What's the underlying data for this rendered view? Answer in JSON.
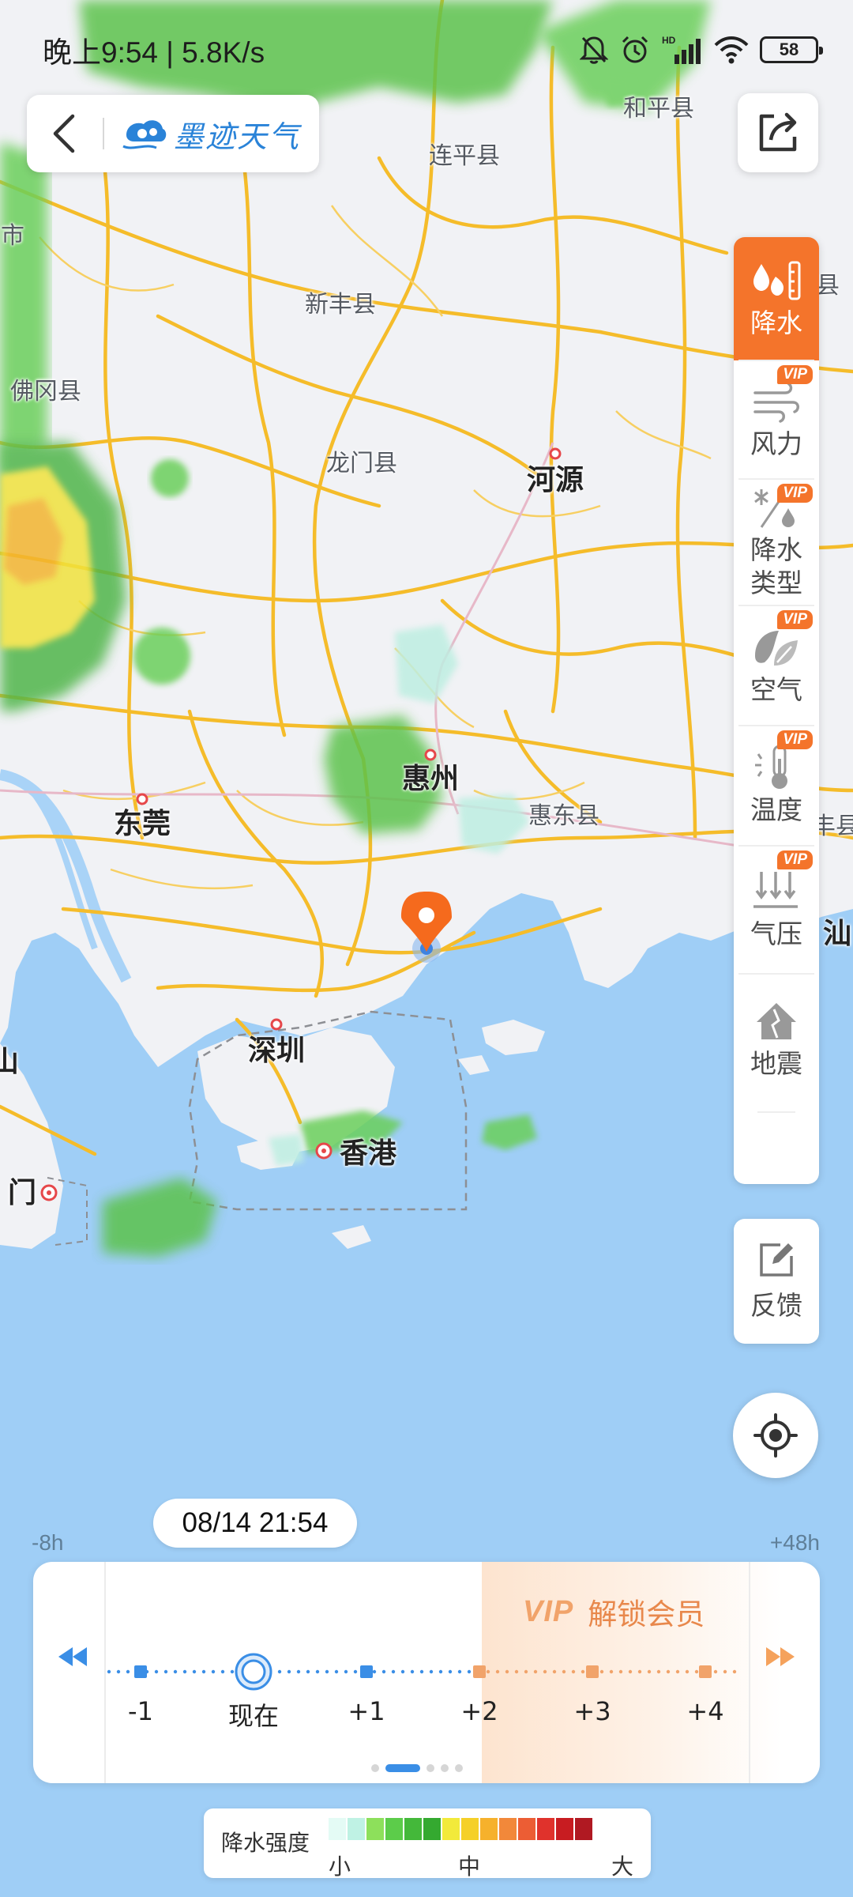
{
  "status_bar": {
    "time_speed": "晚上9:54 | 5.8K/s",
    "network_badge": "HD",
    "battery": "58",
    "icons": [
      "mute-icon",
      "alarm-icon",
      "signal-icon",
      "wifi-icon",
      "battery-icon"
    ]
  },
  "header": {
    "back_icon": "chevron-left-icon",
    "brand_logo": "moji-logo-icon",
    "brand_name": "墨迹天气",
    "share_icon": "share-icon"
  },
  "map": {
    "places": [
      {
        "name": "连平县",
        "rank": "minor"
      },
      {
        "name": "和平县",
        "rank": "minor"
      },
      {
        "name": "新丰县",
        "rank": "minor"
      },
      {
        "name": "佛冈县",
        "rank": "minor"
      },
      {
        "name": "龙门县",
        "rank": "minor"
      },
      {
        "name": "河源",
        "rank": "major"
      },
      {
        "name": "惠州",
        "rank": "major"
      },
      {
        "name": "东莞",
        "rank": "major"
      },
      {
        "name": "惠东县",
        "rank": "minor"
      },
      {
        "name": "深圳",
        "rank": "major"
      },
      {
        "name": "香港",
        "rank": "major"
      },
      {
        "name": "门",
        "rank": "major"
      },
      {
        "name": "市",
        "rank": "minor"
      },
      {
        "name": "县",
        "rank": "minor"
      },
      {
        "name": "丰县",
        "rank": "minor"
      },
      {
        "name": "汕",
        "rank": "major"
      },
      {
        "name": "山",
        "rank": "major"
      }
    ],
    "location_pin": "location-pin-icon",
    "colors": {
      "sea": "#9fcef6",
      "land": "#f1f2f5",
      "road": "#f5bc2a",
      "river": "#a9d3f7"
    }
  },
  "layers": [
    {
      "id": "precip",
      "label": "降水",
      "vip": false,
      "active": true,
      "icon": "precipitation-icon"
    },
    {
      "id": "wind",
      "label": "风力",
      "vip": true,
      "active": false,
      "icon": "wind-icon"
    },
    {
      "id": "ptype",
      "label": "降水类型",
      "label_lines": [
        "降水",
        "类型"
      ],
      "vip": true,
      "active": false,
      "icon": "precip-type-icon"
    },
    {
      "id": "air",
      "label": "空气",
      "vip": true,
      "active": false,
      "icon": "leaf-icon"
    },
    {
      "id": "temp",
      "label": "温度",
      "vip": true,
      "active": false,
      "icon": "thermometer-icon"
    },
    {
      "id": "pressure",
      "label": "气压",
      "vip": true,
      "active": false,
      "icon": "pressure-icon"
    },
    {
      "id": "quake",
      "label": "地震",
      "vip": false,
      "active": false,
      "icon": "earthquake-icon"
    }
  ],
  "vip_badge": "VIP",
  "feedback": {
    "label": "反馈",
    "icon": "edit-icon"
  },
  "locate": {
    "icon": "locate-icon"
  },
  "timeline": {
    "current_time": "08/14 21:54",
    "range_start": "-8h",
    "range_end": "+48h",
    "unlock_vip": "VIP",
    "unlock_text": "解锁会员",
    "ticks": [
      "-1",
      "现在",
      "+1",
      "+2",
      "+3",
      "+4"
    ],
    "current_index": 1,
    "locked_from_index": 3,
    "page_count": 5,
    "active_page": 1,
    "colors": {
      "free": "#3a8ee6",
      "locked": "#f1a36a"
    }
  },
  "legend": {
    "title": "降水强度",
    "low": "小",
    "mid": "中",
    "high": "大",
    "colors": [
      "#e4fbf5",
      "#bff2e4",
      "#8de05b",
      "#5ccc4a",
      "#44b83a",
      "#34a930",
      "#f2ea3a",
      "#f5d028",
      "#f6b12c",
      "#f2883a",
      "#ec5d34",
      "#e0322c",
      "#c81c21",
      "#b01922"
    ]
  }
}
